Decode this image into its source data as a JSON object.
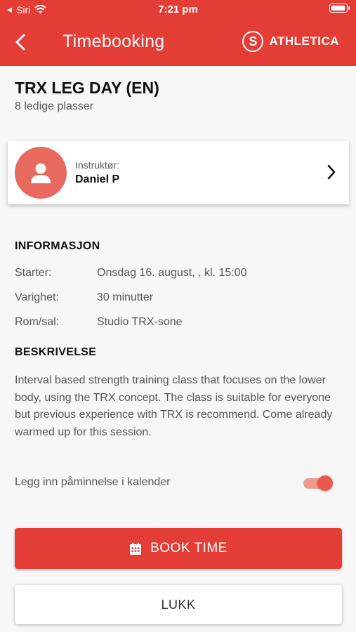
{
  "statusbar": {
    "back_app": "Siri",
    "time": "7:21 pm"
  },
  "header": {
    "title": "Timebooking",
    "brand_letter": "S",
    "brand_name": "ATHLETICA",
    "color": "#e33d35"
  },
  "session": {
    "title": "TRX LEG DAY (EN)",
    "availability": "8 ledige plasser"
  },
  "instructor": {
    "label": "Instruktør:",
    "name": "Daniel P"
  },
  "info": {
    "heading": "INFORMASJON",
    "rows": [
      {
        "label": "Starter:",
        "value": "Onsdag 16. august, , kl. 15:00"
      },
      {
        "label": "Varighet:",
        "value": "30 minutter"
      },
      {
        "label": "Rom/sal:",
        "value": "Studio TRX-sone"
      }
    ]
  },
  "description": {
    "heading": "BESKRIVELSE",
    "text": "Interval based strength training class that focuses on the lower body, using the TRX concept. The class is suitable for everyone but previous experience with TRX is recommend.  Come already warmed up for this session."
  },
  "reminder": {
    "label": "Legg inn påminnelse i kalender",
    "enabled": true
  },
  "actions": {
    "book_label": "BOOK TIME",
    "close_label": "LUKK"
  }
}
